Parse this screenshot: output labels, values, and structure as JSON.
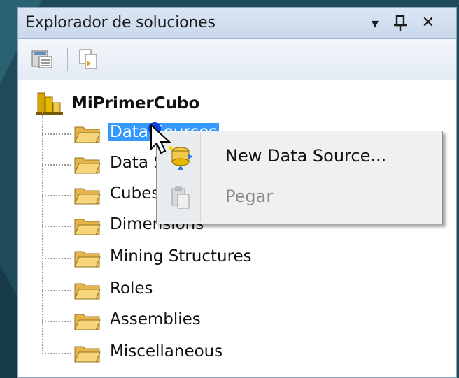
{
  "panel": {
    "title": "Explorador de soluciones",
    "controls": {
      "dropdown": "▾",
      "pin": "⊣",
      "close": "✕"
    }
  },
  "toolbar": {
    "icons": [
      "properties-icon",
      "show-all-files-icon"
    ]
  },
  "tree": {
    "root": {
      "label": "MiPrimerCubo",
      "icon": "project-cube-icon"
    },
    "items": [
      {
        "label": "Data Sources",
        "selected": true
      },
      {
        "label": "Data Source Views",
        "selected": false
      },
      {
        "label": "Cubes",
        "selected": false
      },
      {
        "label": "Dimensions",
        "selected": false
      },
      {
        "label": "Mining Structures",
        "selected": false
      },
      {
        "label": "Roles",
        "selected": false
      },
      {
        "label": "Assemblies",
        "selected": false
      },
      {
        "label": "Miscellaneous",
        "selected": false
      }
    ]
  },
  "context_menu": {
    "items": [
      {
        "label": "New Data Source...",
        "enabled": true,
        "icon": "new-data-source-icon"
      },
      {
        "label": "Pegar",
        "enabled": false,
        "icon": "paste-icon"
      }
    ]
  },
  "colors": {
    "background": "#1f4a5a",
    "selection": "#3399ff",
    "titlebar": "#c9d8ec"
  }
}
